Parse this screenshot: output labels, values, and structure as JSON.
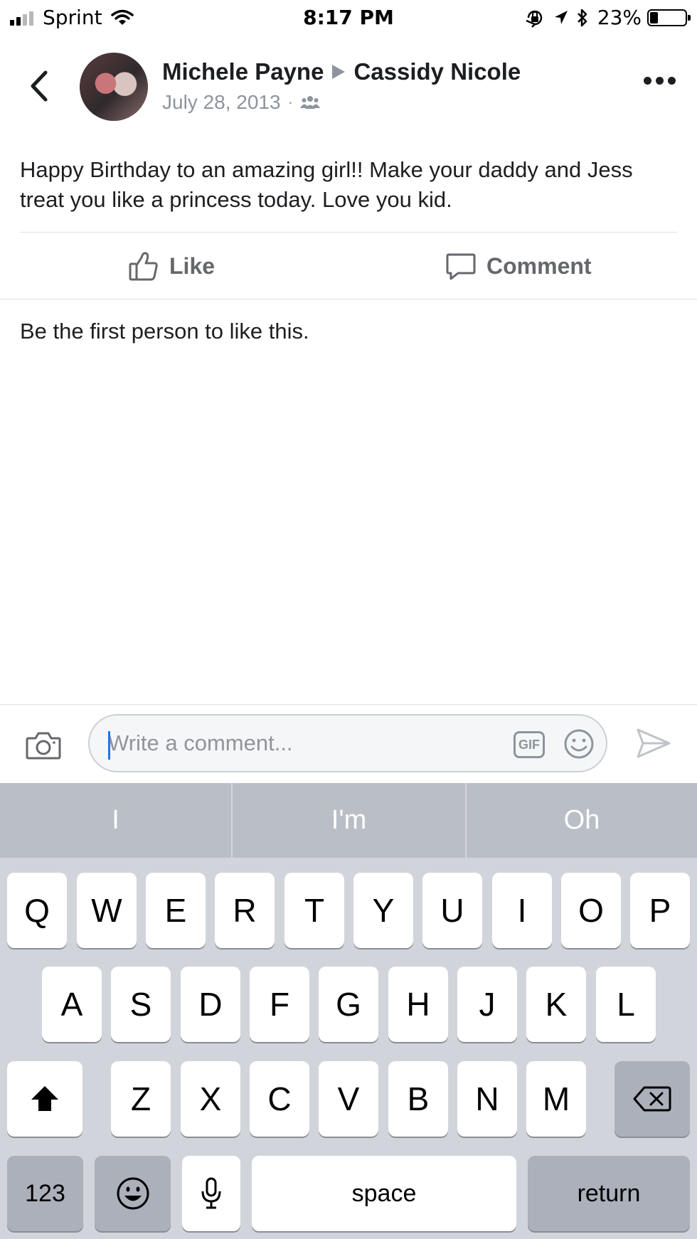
{
  "status_bar": {
    "carrier": "Sprint",
    "time": "8:17 PM",
    "battery": "23%",
    "battery_level": 0.23,
    "icons": [
      "signal-icon",
      "wifi-icon",
      "orientation-lock-icon",
      "location-icon",
      "bluetooth-icon",
      "battery-icon"
    ]
  },
  "post": {
    "author": "Michele Payne",
    "recipient": "Cassidy Nicole",
    "date": "July 28, 2013",
    "privacy_icon": "friends-icon",
    "separator": "·",
    "text": "Happy Birthday to an amazing girl!! Make your daddy and Jess treat you like a princess today. Love you kid."
  },
  "actions": {
    "like": "Like",
    "comment": "Comment"
  },
  "reactions_summary": "Be the first person to like this.",
  "comment_box": {
    "placeholder": "Write a comment...",
    "gif_label": "GIF"
  },
  "keyboard": {
    "predictions": [
      "I",
      "I'm",
      "Oh"
    ],
    "row1": [
      "Q",
      "W",
      "E",
      "R",
      "T",
      "Y",
      "U",
      "I",
      "O",
      "P"
    ],
    "row2": [
      "A",
      "S",
      "D",
      "F",
      "G",
      "H",
      "J",
      "K",
      "L"
    ],
    "row3": [
      "Z",
      "X",
      "C",
      "V",
      "B",
      "N",
      "M"
    ],
    "numbers_label": "123",
    "space_label": "space",
    "return_label": "return"
  },
  "colors": {
    "accent": "#1877f2",
    "secondary_text": "#8d949e",
    "keyboard_bg": "#d1d4da",
    "prediction_bg": "#babec6"
  }
}
